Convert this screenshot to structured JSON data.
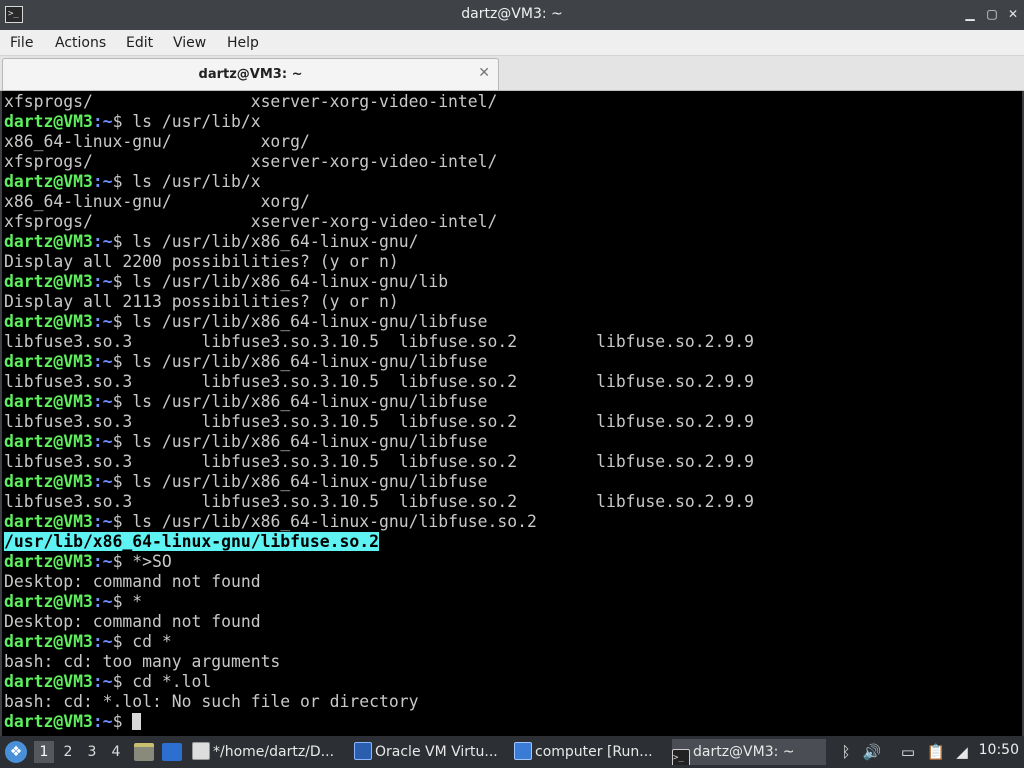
{
  "window": {
    "title": "dartz@VM3: ~",
    "icon": "terminal-icon",
    "buttons": {
      "minimize": "▁",
      "maximize": "▢",
      "close": "✕"
    }
  },
  "menu": [
    "File",
    "Actions",
    "Edit",
    "View",
    "Help"
  ],
  "tab": {
    "label": "dartz@VM3: ~",
    "close": "✕"
  },
  "terminal": {
    "prompt_user": "dartz@VM3",
    "prompt_path": ":~",
    "prompt_symbol": "$ ",
    "lines": [
      {
        "type": "out",
        "text": "xfsprogs/                xserver-xorg-video-intel/"
      },
      {
        "type": "cmd",
        "text": "ls /usr/lib/x"
      },
      {
        "type": "out",
        "text": "x86_64-linux-gnu/         xorg/"
      },
      {
        "type": "out",
        "text": "xfsprogs/                xserver-xorg-video-intel/"
      },
      {
        "type": "cmd",
        "text": "ls /usr/lib/x"
      },
      {
        "type": "out",
        "text": "x86_64-linux-gnu/         xorg/"
      },
      {
        "type": "out",
        "text": "xfsprogs/                xserver-xorg-video-intel/"
      },
      {
        "type": "cmd",
        "text": "ls /usr/lib/x86_64-linux-gnu/"
      },
      {
        "type": "out",
        "text": "Display all 2200 possibilities? (y or n)"
      },
      {
        "type": "cmd",
        "text": "ls /usr/lib/x86_64-linux-gnu/lib"
      },
      {
        "type": "out",
        "text": "Display all 2113 possibilities? (y or n)"
      },
      {
        "type": "cmd",
        "text": "ls /usr/lib/x86_64-linux-gnu/libfuse"
      },
      {
        "type": "out",
        "text": "libfuse3.so.3       libfuse3.so.3.10.5  libfuse.so.2        libfuse.so.2.9.9"
      },
      {
        "type": "cmd",
        "text": "ls /usr/lib/x86_64-linux-gnu/libfuse"
      },
      {
        "type": "out",
        "text": "libfuse3.so.3       libfuse3.so.3.10.5  libfuse.so.2        libfuse.so.2.9.9"
      },
      {
        "type": "cmd",
        "text": "ls /usr/lib/x86_64-linux-gnu/libfuse"
      },
      {
        "type": "out",
        "text": "libfuse3.so.3       libfuse3.so.3.10.5  libfuse.so.2        libfuse.so.2.9.9"
      },
      {
        "type": "cmd",
        "text": "ls /usr/lib/x86_64-linux-gnu/libfuse"
      },
      {
        "type": "out",
        "text": "libfuse3.so.3       libfuse3.so.3.10.5  libfuse.so.2        libfuse.so.2.9.9"
      },
      {
        "type": "cmd",
        "text": "ls /usr/lib/x86_64-linux-gnu/libfuse"
      },
      {
        "type": "out",
        "text": "libfuse3.so.3       libfuse3.so.3.10.5  libfuse.so.2        libfuse.so.2.9.9"
      },
      {
        "type": "cmd",
        "text": "ls /usr/lib/x86_64-linux-gnu/libfuse.so.2"
      },
      {
        "type": "hl",
        "text": "/usr/lib/x86_64-linux-gnu/libfuse.so.2"
      },
      {
        "type": "cmd",
        "text": "*>SO"
      },
      {
        "type": "out",
        "text": "Desktop: command not found"
      },
      {
        "type": "cmd",
        "text": "*"
      },
      {
        "type": "out",
        "text": "Desktop: command not found"
      },
      {
        "type": "cmd",
        "text": "cd *"
      },
      {
        "type": "out",
        "text": "bash: cd: too many arguments"
      },
      {
        "type": "cmd",
        "text": "cd *.lol"
      },
      {
        "type": "out",
        "text": "bash: cd: *.lol: No such file or directory"
      },
      {
        "type": "cmd",
        "text": "",
        "cursor": true
      }
    ]
  },
  "taskbar": {
    "start_icon": "start-menu-icon",
    "workspaces": [
      "1",
      "2",
      "3",
      "4"
    ],
    "active_workspace": "1",
    "launchers": [
      "file-manager-icon",
      "desktop-icon"
    ],
    "tasks": [
      {
        "label": "*/home/dartz/D...",
        "icon": "text-editor-icon",
        "active": false
      },
      {
        "label": "Oracle VM Virtu...",
        "icon": "virtualbox-icon",
        "active": false
      },
      {
        "label": "computer [Run...",
        "icon": "vm-window-icon",
        "active": false
      },
      {
        "label": "dartz@VM3: ~",
        "icon": "terminal-icon",
        "active": true
      }
    ],
    "tray": [
      "bluetooth-icon",
      "volume-icon",
      "display-icon",
      "clipboard-icon",
      "network-icon"
    ],
    "clock": "10:50"
  }
}
